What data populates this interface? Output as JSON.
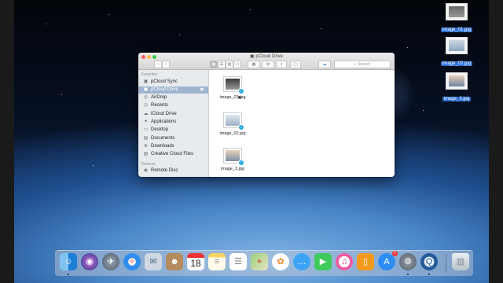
{
  "window": {
    "title": "pCloud Drive",
    "search_placeholder": "Search",
    "toolbar": {
      "back": "‹",
      "forward": "›",
      "view_icons": "▦",
      "view_list": "☰",
      "view_columns": "▥",
      "view_gallery": "▭",
      "group": "▦",
      "action": "⚙",
      "share": "⇪",
      "tags": "◯",
      "dropbox": "☁"
    }
  },
  "sidebar": {
    "favorites_label": "Favorites",
    "devices_label": "Devices",
    "items": [
      {
        "label": "pCloud Sync",
        "icon": "▣"
      },
      {
        "label": "pCloud Drive",
        "icon": "▣"
      },
      {
        "label": "AirDrop",
        "icon": "◎"
      },
      {
        "label": "Recents",
        "icon": "◷"
      },
      {
        "label": "iCloud Drive",
        "icon": "☁"
      },
      {
        "label": "Applications",
        "icon": "✦"
      },
      {
        "label": "Desktop",
        "icon": "▭"
      },
      {
        "label": "Documents",
        "icon": "▤"
      },
      {
        "label": "Downloads",
        "icon": "⊕"
      },
      {
        "label": "Creative Cloud Files",
        "icon": "▤"
      }
    ],
    "devices": [
      {
        "label": "Remote Disc",
        "icon": "◉"
      }
    ],
    "eject_icon": "⏏"
  },
  "files": [
    {
      "name": "image_01.jpg"
    },
    {
      "name": "image_02.jpg"
    },
    {
      "name": "image_3.jpg"
    }
  ],
  "desktop_icons": [
    {
      "name": "image_01.jpg"
    },
    {
      "name": "image_02.jpg"
    },
    {
      "name": "image_3.jpg"
    }
  ],
  "dock": {
    "calendar_day": "18",
    "app_store_badge": "1",
    "apps": [
      "finder",
      "siri",
      "launchpad",
      "safari",
      "mail-stamp",
      "contacts",
      "calendar",
      "notes",
      "reminders",
      "maps",
      "photos",
      "messages",
      "facetime",
      "itunes",
      "ibooks",
      "app-store",
      "system-preferences",
      "quicktime",
      "trash"
    ]
  },
  "colors": {
    "selection": "#9fb5cf",
    "badge_blue": "#26a9e0",
    "desktop_label": "#2b6fd6"
  }
}
